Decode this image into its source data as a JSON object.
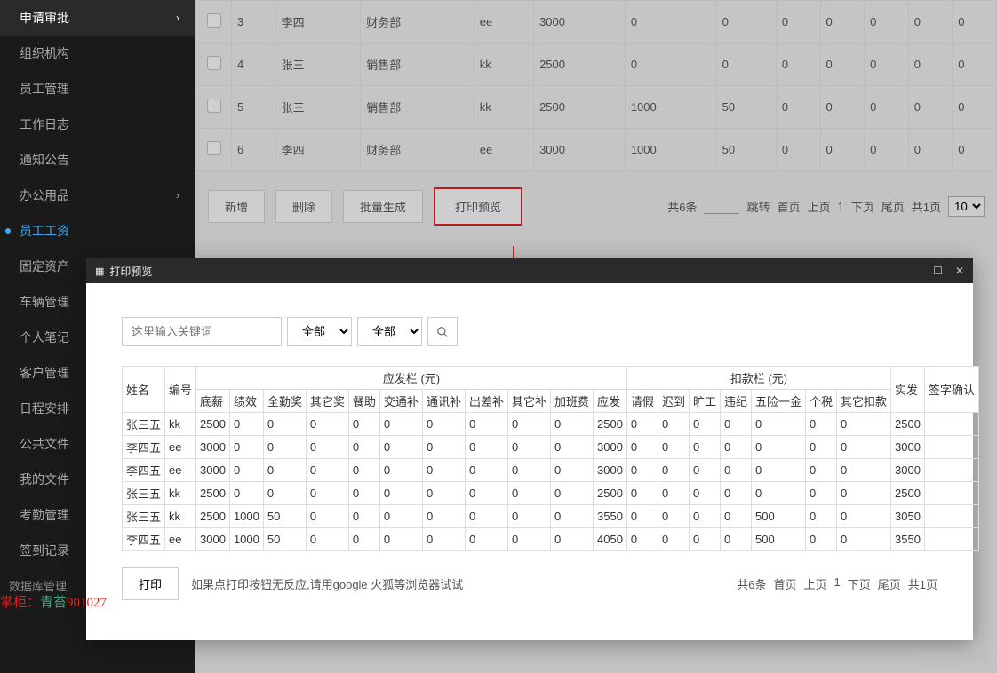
{
  "sidebar": {
    "items": [
      {
        "label": "申请审批",
        "chev": true
      },
      {
        "label": "组织机构"
      },
      {
        "label": "员工管理"
      },
      {
        "label": "工作日志"
      },
      {
        "label": "通知公告"
      },
      {
        "label": "办公用品",
        "chev": true
      },
      {
        "label": "员工工资",
        "active": true
      },
      {
        "label": "固定资产"
      },
      {
        "label": "车辆管理"
      },
      {
        "label": "个人笔记"
      },
      {
        "label": "客户管理"
      },
      {
        "label": "日程安排"
      },
      {
        "label": "公共文件"
      },
      {
        "label": "我的文件"
      },
      {
        "label": "考勤管理"
      },
      {
        "label": "签到记录"
      }
    ],
    "section": "数据库管理"
  },
  "bg": {
    "rows": [
      {
        "idx": "3",
        "name": "李四",
        "dept": "财务部",
        "code": "ee",
        "base": "3000",
        "c": [
          "0",
          "0",
          "0",
          "0",
          "0",
          "0",
          "0"
        ]
      },
      {
        "idx": "4",
        "name": "张三",
        "dept": "销售部",
        "code": "kk",
        "base": "2500",
        "c": [
          "0",
          "0",
          "0",
          "0",
          "0",
          "0",
          "0"
        ]
      },
      {
        "idx": "5",
        "name": "张三",
        "dept": "销售部",
        "code": "kk",
        "base": "2500",
        "c": [
          "1000",
          "50",
          "0",
          "0",
          "0",
          "0",
          "0"
        ]
      },
      {
        "idx": "6",
        "name": "李四",
        "dept": "财务部",
        "code": "ee",
        "base": "3000",
        "c": [
          "1000",
          "50",
          "0",
          "0",
          "0",
          "0",
          "0"
        ]
      }
    ],
    "buttons": {
      "add": "新增",
      "del": "删除",
      "batch": "批量生成",
      "print": "打印预览"
    },
    "pager": {
      "total": "共6条",
      "jump": "跳转",
      "first": "首页",
      "prev": "上页",
      "page": "1",
      "next": "下页",
      "last": "尾页",
      "pages": "共1页",
      "size": "10"
    }
  },
  "modal": {
    "title": "打印预览",
    "search": {
      "placeholder": "这里输入关键词",
      "opt1": "全部",
      "opt2": "全部"
    },
    "headers": {
      "name": "姓名",
      "code": "编号",
      "yf_group": "应发栏 (元)",
      "kk_group": "扣款栏 (元)",
      "base": "底薪",
      "perf": "绩效",
      "attend": "全勤奖",
      "other1": "其它奖",
      "meal": "餐助",
      "trans": "交通补",
      "comm": "通讯补",
      "trip": "出差补",
      "other2": "其它补",
      "ot": "加班费",
      "yf": "应发",
      "leave": "请假",
      "late": "迟到",
      "absent": "旷工",
      "viol": "违纪",
      "ins": "五险一金",
      "tax": "个税",
      "otherk": "其它扣款",
      "sf": "实发",
      "sign": "签字确认"
    },
    "rows": [
      {
        "name": "张三五",
        "code": "kk",
        "base": "2500",
        "perf": "0",
        "attend": "0",
        "other1": "0",
        "meal": "0",
        "trans": "0",
        "comm": "0",
        "trip": "0",
        "other2": "0",
        "ot": "0",
        "yf": "2500",
        "leave": "0",
        "late": "0",
        "absent": "0",
        "viol": "0",
        "ins": "0",
        "tax": "0",
        "otherk": "0",
        "sf": "2500",
        "sign": ""
      },
      {
        "name": "李四五",
        "code": "ee",
        "base": "3000",
        "perf": "0",
        "attend": "0",
        "other1": "0",
        "meal": "0",
        "trans": "0",
        "comm": "0",
        "trip": "0",
        "other2": "0",
        "ot": "0",
        "yf": "3000",
        "leave": "0",
        "late": "0",
        "absent": "0",
        "viol": "0",
        "ins": "0",
        "tax": "0",
        "otherk": "0",
        "sf": "3000",
        "sign": ""
      },
      {
        "name": "李四五",
        "code": "ee",
        "base": "3000",
        "perf": "0",
        "attend": "0",
        "other1": "0",
        "meal": "0",
        "trans": "0",
        "comm": "0",
        "trip": "0",
        "other2": "0",
        "ot": "0",
        "yf": "3000",
        "leave": "0",
        "late": "0",
        "absent": "0",
        "viol": "0",
        "ins": "0",
        "tax": "0",
        "otherk": "0",
        "sf": "3000",
        "sign": ""
      },
      {
        "name": "张三五",
        "code": "kk",
        "base": "2500",
        "perf": "0",
        "attend": "0",
        "other1": "0",
        "meal": "0",
        "trans": "0",
        "comm": "0",
        "trip": "0",
        "other2": "0",
        "ot": "0",
        "yf": "2500",
        "leave": "0",
        "late": "0",
        "absent": "0",
        "viol": "0",
        "ins": "0",
        "tax": "0",
        "otherk": "0",
        "sf": "2500",
        "sign": ""
      },
      {
        "name": "张三五",
        "code": "kk",
        "base": "2500",
        "perf": "1000",
        "attend": "50",
        "other1": "0",
        "meal": "0",
        "trans": "0",
        "comm": "0",
        "trip": "0",
        "other2": "0",
        "ot": "0",
        "yf": "3550",
        "leave": "0",
        "late": "0",
        "absent": "0",
        "viol": "0",
        "ins": "500",
        "tax": "0",
        "otherk": "0",
        "sf": "3050",
        "sign": ""
      },
      {
        "name": "李四五",
        "code": "ee",
        "base": "3000",
        "perf": "1000",
        "attend": "50",
        "other1": "0",
        "meal": "0",
        "trans": "0",
        "comm": "0",
        "trip": "0",
        "other2": "0",
        "ot": "0",
        "yf": "4050",
        "leave": "0",
        "late": "0",
        "absent": "0",
        "viol": "0",
        "ins": "500",
        "tax": "0",
        "otherk": "0",
        "sf": "3550",
        "sign": ""
      }
    ],
    "footer": {
      "print": "打印",
      "hint": "如果点打印按钮无反应,请用google 火狐等浏览器试试",
      "pager": {
        "total": "共6条",
        "first": "首页",
        "prev": "上页",
        "page": "1",
        "next": "下页",
        "last": "尾页",
        "pages": "共1页"
      }
    }
  },
  "watermark": {
    "a": "掌柜：",
    "b": "青苔",
    "c": "901027",
    "d": "@51CTO博客"
  }
}
